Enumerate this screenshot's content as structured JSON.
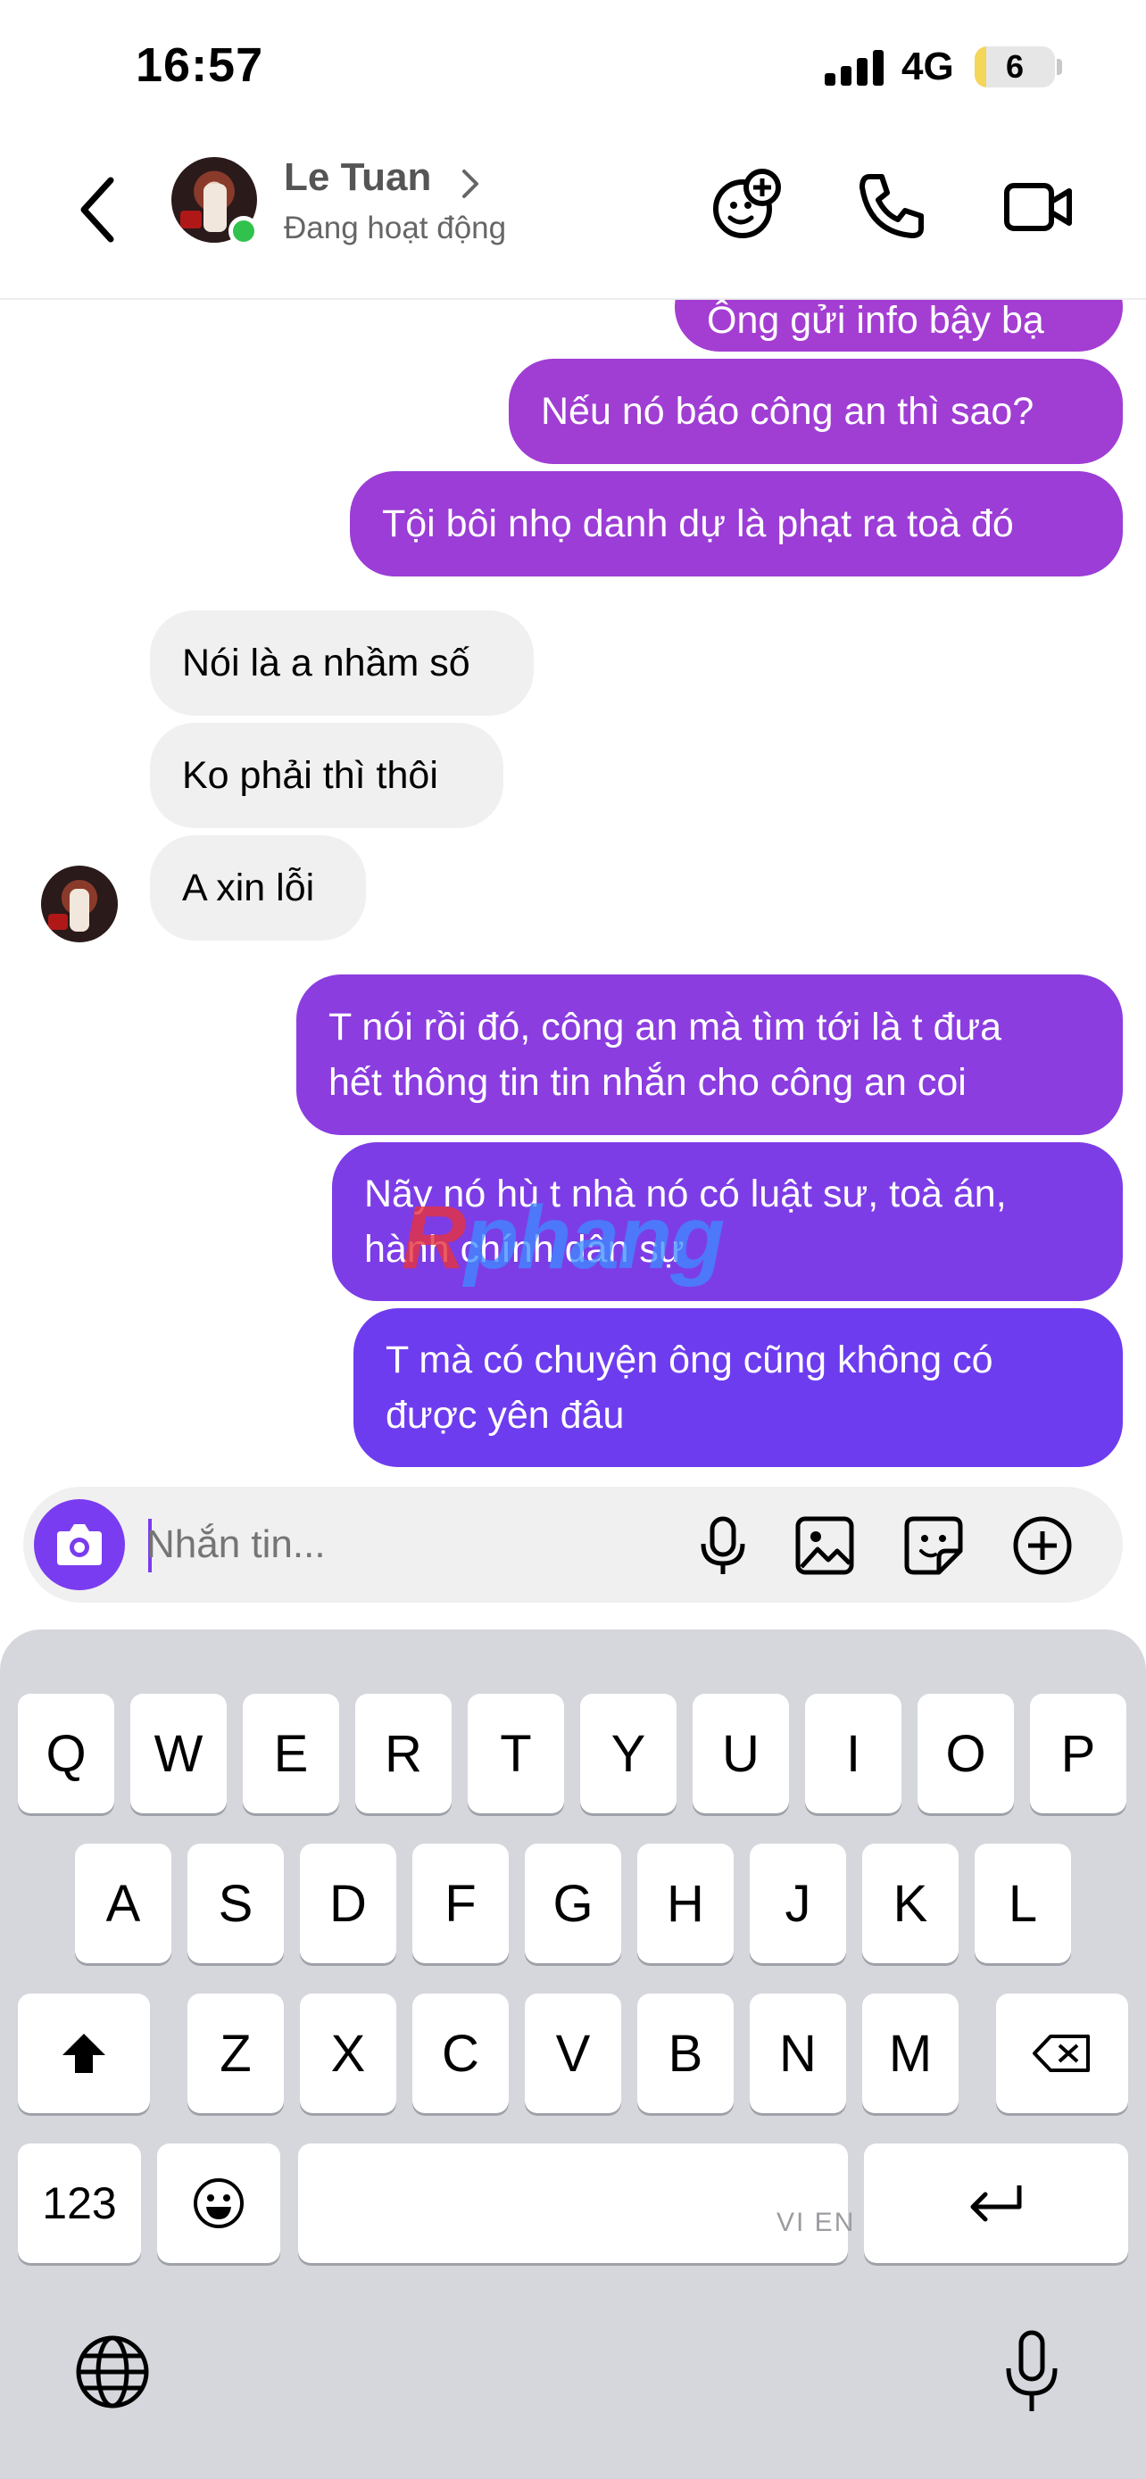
{
  "status_bar": {
    "time": "16:57",
    "network": "4G",
    "battery": "6"
  },
  "header": {
    "contact_name": "Le Tuan",
    "contact_status": "Đang hoạt động"
  },
  "messages": [
    {
      "dir": "out",
      "text": "Ông gửi info bậy bạ"
    },
    {
      "dir": "out",
      "text": "Nếu nó báo công an thì sao?"
    },
    {
      "dir": "out",
      "text": "Tội bôi nhọ danh dự là phạt ra toà đó"
    },
    {
      "dir": "in",
      "text": "Nói là a nhầm số"
    },
    {
      "dir": "in",
      "text": "Ko phải thì thôi"
    },
    {
      "dir": "in",
      "text": "A xin lỗi"
    },
    {
      "dir": "out",
      "text": "T nói rồi đó, công an mà tìm tới là t đưa\nhết thông tin tin nhắn cho công an coi"
    },
    {
      "dir": "out",
      "text": "Nãy nó hù t nhà nó có luật sư, toà án,\nhành chính dân sự"
    },
    {
      "dir": "out",
      "text": "T mà có chuyện ông cũng không có\nđược yên đâu"
    }
  ],
  "watermark": {
    "prefix": "R",
    "text": "phang"
  },
  "composer": {
    "placeholder": "Nhắn tin..."
  },
  "keyboard": {
    "row1": [
      "Q",
      "W",
      "E",
      "R",
      "T",
      "Y",
      "U",
      "I",
      "O",
      "P"
    ],
    "row2": [
      "A",
      "S",
      "D",
      "F",
      "G",
      "H",
      "J",
      "K",
      "L"
    ],
    "row3": [
      "Z",
      "X",
      "C",
      "V",
      "B",
      "N",
      "M"
    ],
    "numbers_key": "123",
    "language_label": "VI EN"
  },
  "colors": {
    "bubble_top": "#a43ed2",
    "bubble_bottom": "#6a3cf0",
    "accent": "#7a3cf0",
    "online": "#31c24d"
  }
}
